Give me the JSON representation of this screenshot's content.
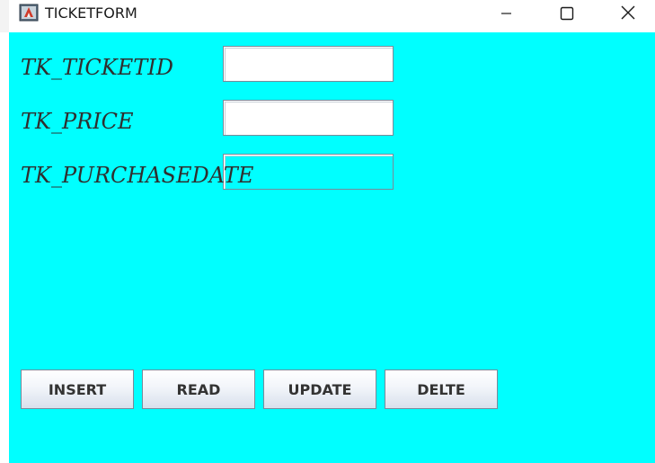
{
  "window": {
    "title": "TICKETFORM",
    "background_color": "#00ffff",
    "controls": {
      "minimize_icon": "minimize-icon",
      "maximize_icon": "maximize-icon",
      "close_icon": "close-icon"
    }
  },
  "form": {
    "fields": [
      {
        "label": "TK_TICKETID",
        "value": ""
      },
      {
        "label": "TK_PRICE",
        "value": ""
      },
      {
        "label": "TK_PURCHASEDATE",
        "value": ""
      }
    ]
  },
  "buttons": {
    "insert": "INSERT",
    "read": "READ",
    "update": "UPDATE",
    "delete": "DELTE"
  }
}
